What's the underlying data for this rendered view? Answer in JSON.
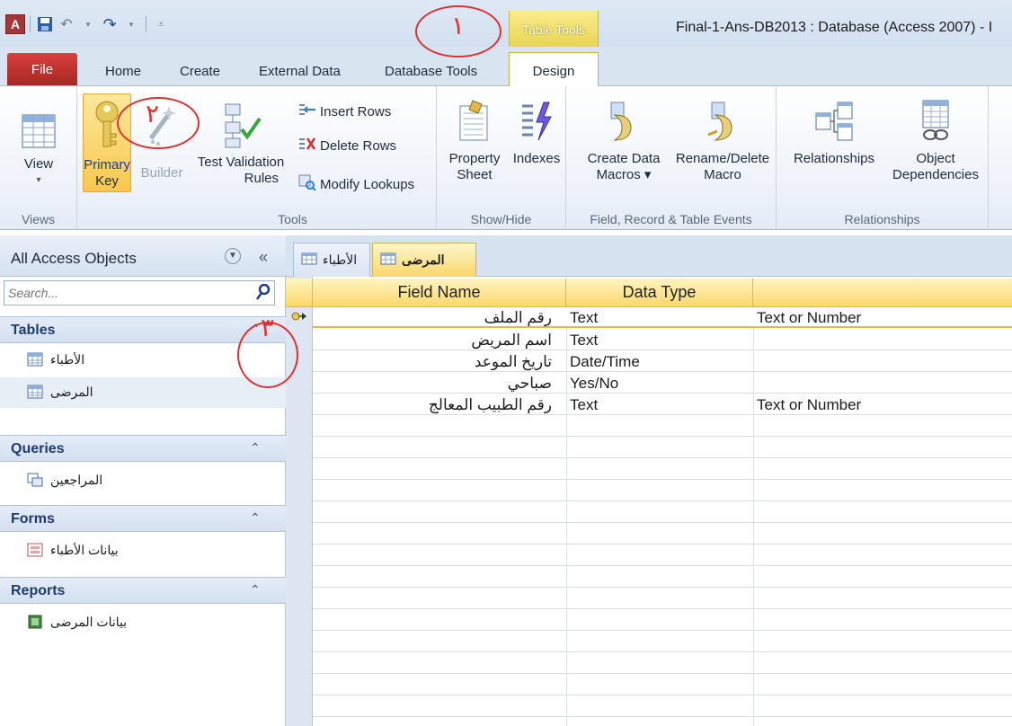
{
  "window": {
    "title": "Final-1-Ans-DB2013 : Database (Access 2007) - I",
    "app_icon": "A",
    "contextual_tab_group": "Table Tools"
  },
  "ribbon_tabs": [
    "File",
    "Home",
    "Create",
    "External Data",
    "Database Tools",
    "Design"
  ],
  "ribbon": {
    "views": {
      "view_label": "View",
      "group_label": "Views"
    },
    "tools": {
      "primary_key_line1": "Primary",
      "primary_key_line2": "Key",
      "builder": "Builder",
      "test_validation_line1": "Test Validation",
      "test_validation_line2": "Rules",
      "insert_rows": "Insert Rows",
      "delete_rows": "Delete Rows",
      "modify_lookups": "Modify Lookups",
      "group_label": "Tools"
    },
    "show_hide": {
      "property_sheet_line1": "Property",
      "property_sheet_line2": "Sheet",
      "indexes": "Indexes",
      "group_label": "Show/Hide"
    },
    "events": {
      "create_data_macros_line1": "Create Data",
      "create_data_macros_line2": "Macros ▾",
      "rename_delete_macro_line1": "Rename/Delete",
      "rename_delete_macro_line2": "Macro",
      "group_label": "Field, Record & Table Events"
    },
    "relationships": {
      "relationships": "Relationships",
      "object_dependencies_line1": "Object",
      "object_dependencies_line2": "Dependencies",
      "group_label": "Relationships"
    }
  },
  "nav": {
    "title": "All Access Objects",
    "search_placeholder": "Search...",
    "groups": [
      {
        "label": "Tables",
        "items": [
          "الأطباء",
          "المرضى"
        ]
      },
      {
        "label": "Queries",
        "items": [
          "المراجعين"
        ]
      },
      {
        "label": "Forms",
        "items": [
          "بيانات الأطباء"
        ]
      },
      {
        "label": "Reports",
        "items": [
          "بيانات المرضى"
        ]
      }
    ]
  },
  "doc_tabs": [
    "الأطباء",
    "المرضى"
  ],
  "grid": {
    "headers": [
      "Field Name",
      "Data Type",
      ""
    ],
    "rows": [
      {
        "field": "رقم الملف",
        "type": "Text",
        "desc": "Text or Number"
      },
      {
        "field": "اسم المريض",
        "type": "Text",
        "desc": ""
      },
      {
        "field": "تاريخ الموعد",
        "type": "Date/Time",
        "desc": ""
      },
      {
        "field": "صباحي",
        "type": "Yes/No",
        "desc": ""
      },
      {
        "field": "رقم الطبيب المعالج",
        "type": "Text",
        "desc": "Text or Number"
      }
    ]
  },
  "annotations": [
    "١",
    "٢",
    "٣"
  ],
  "colors": {
    "file_tab": "#c0302c",
    "contextual": "#f2df6b",
    "annotation": "#e03030"
  }
}
